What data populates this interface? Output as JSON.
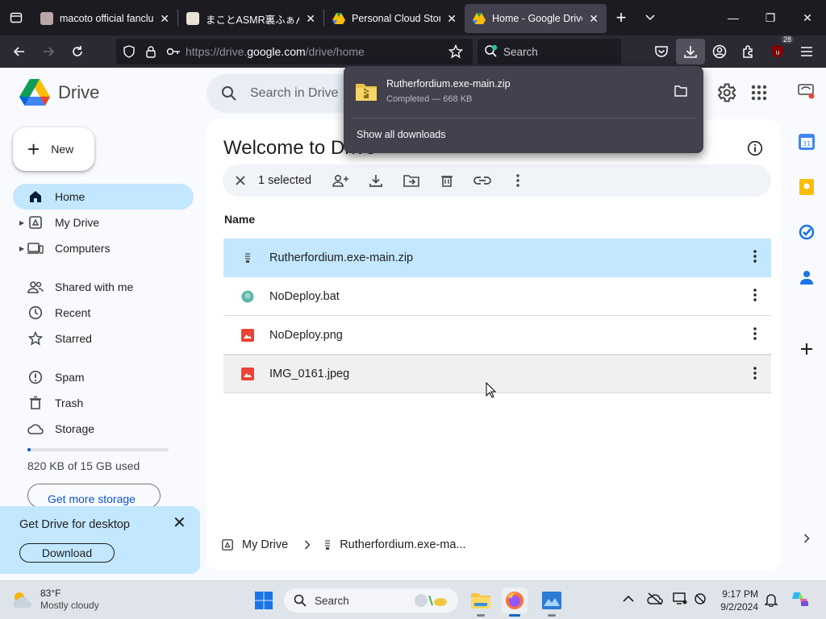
{
  "browser": {
    "tabs": [
      {
        "title": "macoto official fanclub",
        "active": false
      },
      {
        "title": "まことASMR裏ふぁんく",
        "active": false
      },
      {
        "title": "Personal Cloud Storage",
        "active": false
      },
      {
        "title": "Home - Google Drive",
        "active": true
      }
    ],
    "url_prefix": "https://drive.",
    "url_domain": "google.com",
    "url_path": "/drive/home",
    "search_placeholder": "Search",
    "extension_badge": "28"
  },
  "downloads": {
    "file_name": "Rutherfordium.exe-main.zip",
    "status": "Completed — 668 KB",
    "show_all": "Show all downloads"
  },
  "drive": {
    "app_name": "Drive",
    "new_label": "New",
    "search_placeholder": "Search in Drive",
    "nav": [
      {
        "label": "Home"
      },
      {
        "label": "My Drive"
      },
      {
        "label": "Computers"
      },
      {
        "label": "Shared with me"
      },
      {
        "label": "Recent"
      },
      {
        "label": "Starred"
      },
      {
        "label": "Spam"
      },
      {
        "label": "Trash"
      },
      {
        "label": "Storage"
      }
    ],
    "storage_used": "820 KB of 15 GB used",
    "storage_fraction": 0.01,
    "get_storage_label": "Get more storage",
    "promo": {
      "title": "Get Drive for desktop",
      "button": "Download"
    },
    "welcome": "Welcome to Drive",
    "selection": {
      "count": "1 selected"
    },
    "column_name": "Name",
    "files": [
      {
        "name": "Rutherfordium.exe-main.zip",
        "type": "zip",
        "selected": true
      },
      {
        "name": "NoDeploy.bat",
        "type": "bat",
        "selected": false
      },
      {
        "name": "NoDeploy.png",
        "type": "image",
        "selected": false
      },
      {
        "name": "IMG_0161.jpeg",
        "type": "image",
        "selected": false
      }
    ],
    "breadcrumb": {
      "root": "My Drive",
      "item": "Rutherfordium.exe-ma..."
    }
  },
  "taskbar": {
    "weather_temp": "83°F",
    "weather_desc": "Mostly cloudy",
    "search_label": "Search",
    "time": "9:17 PM",
    "date": "9/2/2024"
  },
  "colors": {
    "accent": "#0b57d0",
    "selection": "#c2e7ff",
    "browser_bg": "#1c1b22"
  }
}
